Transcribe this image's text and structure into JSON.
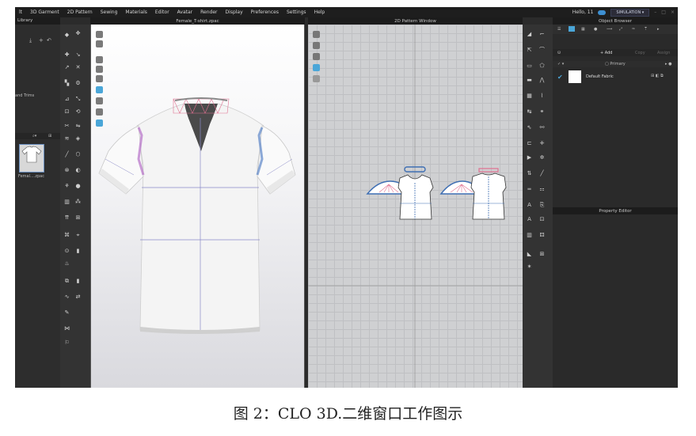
{
  "menu": [
    "lt",
    "3D Garment",
    "2D Pattern",
    "Sewing",
    "Materials",
    "Editor",
    "Avatar",
    "Render",
    "Display",
    "Preferences",
    "Settings",
    "Help"
  ],
  "user": "Hello, 11",
  "sim_label": "SIMULATION",
  "library": {
    "title": "Library",
    "side_text": "and Trims",
    "file_label": "Femal....zpac"
  },
  "viewport3d": {
    "title": "Female_T-shirt.zpac"
  },
  "viewport2d": {
    "title": "2D Pattern Window"
  },
  "object_browser": {
    "title": "Object Browser",
    "add": "+ Add",
    "copy": "Copy",
    "assign": "Assign",
    "primary": "Primary",
    "fabric": "Default Fabric"
  },
  "property_editor": {
    "title": "Property Editor"
  },
  "caption": "图 2：CLO 3D.二维窗口工作图示",
  "colors": {
    "accent": "#4aa6d8",
    "seam_pink": "#e07090",
    "pattern_blue": "#3f6fb3"
  }
}
